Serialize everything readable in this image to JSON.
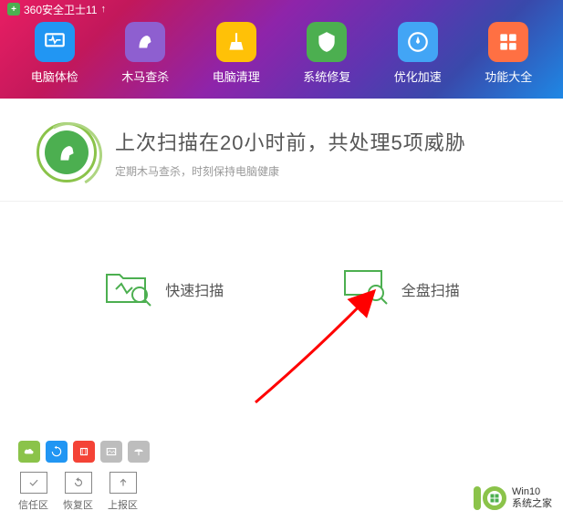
{
  "title_bar": {
    "text": "360安全卫士11"
  },
  "nav": {
    "items": [
      {
        "label": "电脑体检"
      },
      {
        "label": "木马查杀"
      },
      {
        "label": "电脑清理"
      },
      {
        "label": "系统修复"
      },
      {
        "label": "优化加速"
      },
      {
        "label": "功能大全"
      }
    ]
  },
  "status": {
    "title": "上次扫描在20小时前，共处理5项威胁",
    "subtitle": "定期木马查杀，时刻保持电脑健康"
  },
  "scan": {
    "quick": "快速扫描",
    "full": "全盘扫描"
  },
  "zones": {
    "trust": "信任区",
    "restore": "恢复区",
    "report": "上报区"
  },
  "watermark": {
    "line1": "Win10",
    "line2": "系统之家"
  }
}
